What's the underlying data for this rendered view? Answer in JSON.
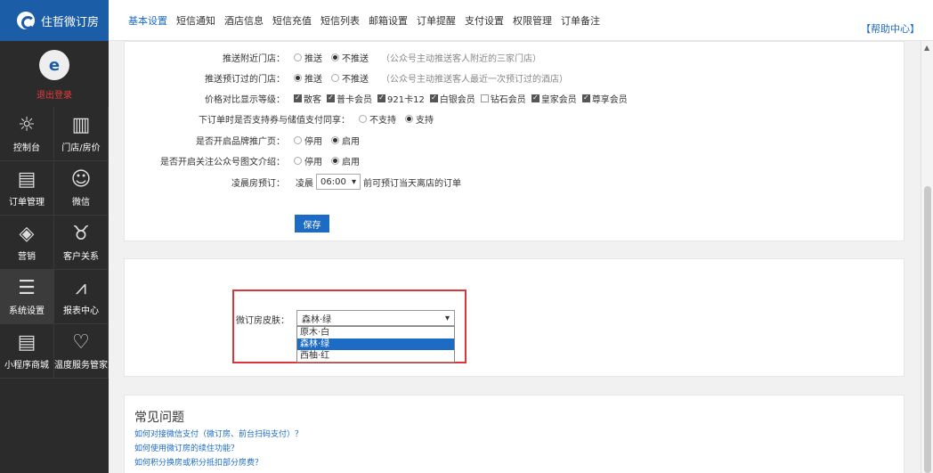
{
  "app": {
    "title": "住哲微订房"
  },
  "sidebar": {
    "logout": "退出登录",
    "items": [
      {
        "label": "控制台",
        "icon": "dashboard-icon"
      },
      {
        "label": "门店/房价",
        "icon": "building-icon"
      },
      {
        "label": "订单管理",
        "icon": "order-icon"
      },
      {
        "label": "微信",
        "icon": "wechat-icon"
      },
      {
        "label": "营销",
        "icon": "sale-tag-icon"
      },
      {
        "label": "客户关系",
        "icon": "wine-glass-icon"
      },
      {
        "label": "系统设置",
        "icon": "sliders-icon"
      },
      {
        "label": "报表中心",
        "icon": "chart-icon"
      },
      {
        "label": "小程序商城",
        "icon": "doc-icon"
      },
      {
        "label": "温度服务管家",
        "icon": "hand-heart-icon"
      }
    ]
  },
  "topbar": {
    "tabs": [
      "基本设置",
      "短信通知",
      "酒店信息",
      "短信充值",
      "短信列表",
      "邮箱设置",
      "订单提醒",
      "支付设置",
      "权限管理",
      "订单备注"
    ],
    "active_tab": "基本设置",
    "help": "【帮助中心】"
  },
  "settings": {
    "nearby": {
      "label": "推送附近门店：",
      "opt1": "推送",
      "opt2": "不推送",
      "hint": "（公众号主动推送客人附近的三家门店）"
    },
    "booked": {
      "label": "推送预订过的门店：",
      "opt1": "推送",
      "opt2": "不推送",
      "hint": "（公众号主动推送客人最近一次预订过的酒店）"
    },
    "price_levels": {
      "label": "价格对比显示等级：",
      "options": [
        {
          "label": "散客",
          "checked": true
        },
        {
          "label": "普卡会员",
          "checked": true
        },
        {
          "label": "921卡12",
          "checked": true
        },
        {
          "label": "白银会员",
          "checked": true
        },
        {
          "label": "钻石会员",
          "checked": false
        },
        {
          "label": "皇家会员",
          "checked": true
        },
        {
          "label": "尊享会员",
          "checked": true
        }
      ]
    },
    "coupon": {
      "label": "下订单时是否支持券与储值支付同享：",
      "opt1": "不支持",
      "opt2": "支持"
    },
    "brand": {
      "label": "是否开启品牌推广页：",
      "opt1": "停用",
      "opt2": "启用"
    },
    "follow": {
      "label": "是否开启关注公众号图文介绍：",
      "opt1": "停用",
      "opt2": "启用"
    },
    "dawn": {
      "label": "凌晨房预订：",
      "prefix": "凌晨",
      "time": "06:00",
      "suffix": "前可预订当天离店的订单"
    },
    "save": "保存"
  },
  "skin": {
    "label": "微订房皮肤：",
    "selected": "森林·绿",
    "options": [
      "原木·白",
      "森林·绿",
      "西柚·红"
    ]
  },
  "faq": {
    "title": "常见问题",
    "links": [
      "如何对接微信支付（微订房、前台扫码支付）？",
      "如何使用微订房的续住功能？",
      "如何积分换房或积分抵扣部分房费？"
    ]
  }
}
